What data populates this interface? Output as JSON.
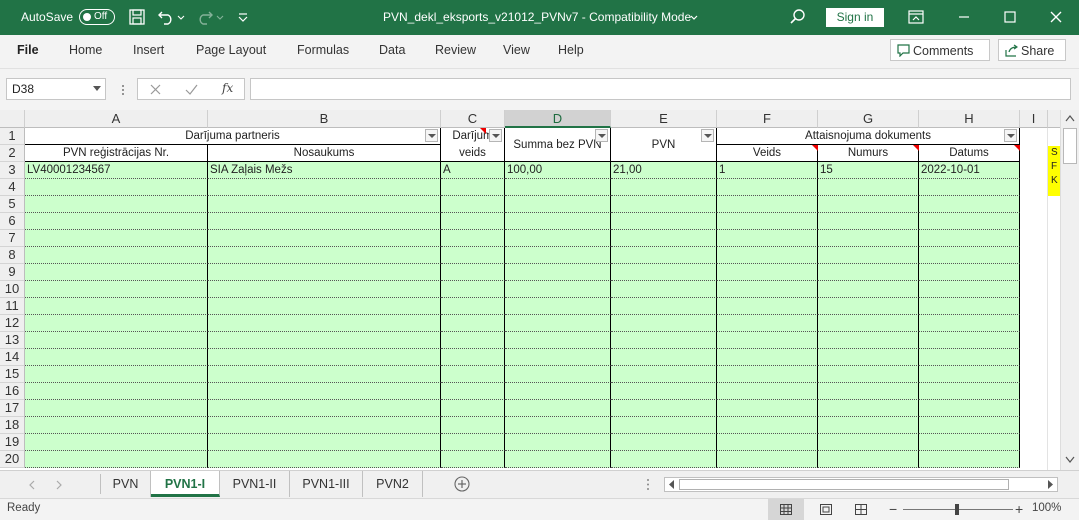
{
  "titlebar": {
    "autosave_label": "AutoSave",
    "autosave_state": "Off",
    "doc_title": "PVN_dekl_eksports_v21012_PVNv7  -  Compatibility Mode",
    "sign_in": "Sign in",
    "bg_color": "#217346"
  },
  "ribbon": {
    "tabs": [
      "File",
      "Home",
      "Insert",
      "Page Layout",
      "Formulas",
      "Data",
      "Review",
      "View",
      "Help"
    ],
    "comments": "Comments",
    "share": "Share"
  },
  "formula_bar": {
    "name_box": "D38",
    "fx": "fx",
    "formula": ""
  },
  "sheet": {
    "columns": [
      "A",
      "B",
      "C",
      "D",
      "E",
      "F",
      "G",
      "H",
      "I"
    ],
    "selected_column": "D",
    "rows": [
      "1",
      "2",
      "3",
      "4",
      "5",
      "6",
      "7",
      "8",
      "9",
      "10",
      "11",
      "12",
      "13",
      "14",
      "15",
      "16",
      "17",
      "18",
      "19",
      "20"
    ],
    "header1": {
      "partners": "Darījuma partneris",
      "type": "Darījum",
      "type2": "veids",
      "amount": "Summa bez PVN",
      "vat": "PVN",
      "doc": "Attaisnojuma dokuments"
    },
    "header2": {
      "reg_no": "PVN reģistrācijas Nr.",
      "name": "Nosaukums",
      "doc_type": "Veids",
      "doc_number": "Numurs",
      "doc_date": "Datums"
    },
    "data_rows": [
      {
        "reg_no": "LV40001234567",
        "name": "SIA Zaļais Mežs",
        "type": "A",
        "amount": "100,00",
        "vat": "21,00",
        "doc_type": "1",
        "doc_number": "15",
        "doc_date": "2022-10-01"
      }
    ],
    "side_note": [
      "S",
      "F",
      "K"
    ],
    "data_fill": "#ccffcc"
  },
  "sheet_tabs": {
    "tabs": [
      "PVN",
      "PVN1-I",
      "PVN1-II",
      "PVN1-III",
      "PVN2"
    ],
    "active": "PVN1-I"
  },
  "status": {
    "ready": "Ready",
    "zoom": "100%"
  }
}
